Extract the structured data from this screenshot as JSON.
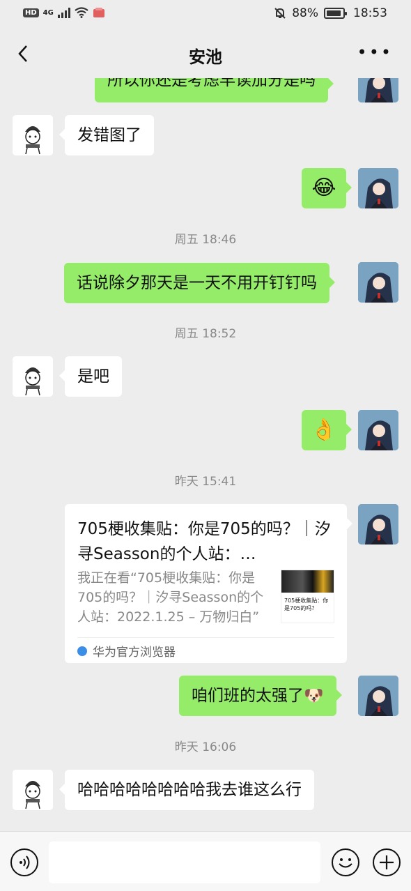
{
  "status": {
    "network": "4G",
    "battery": "88%",
    "time": "18:53"
  },
  "chat": {
    "title": "安池"
  },
  "messages": {
    "m1": "所以你还是考虑早读加分是吗",
    "m2": "发错图了",
    "t1": "周五 18:46",
    "m4": "话说除夕那天是一天不用开钉钉吗",
    "t2": "周五 18:52",
    "m5": "是吧",
    "t3": "昨天 15:41",
    "m7": "咱们班的太强了",
    "t4": "昨天 16:06",
    "m8": "哈哈哈哈哈哈哈哈我去谁这么行"
  },
  "link_card": {
    "title": "705梗收集贴：你是705的吗？｜汐寻Seasson的个人站：…",
    "desc": "我正在看“705梗收集贴：你是705的吗？｜汐寻Seasson的个人站：2022.1.25 – 万物归白”",
    "thumb_text": "705梗收集贴：你是705的吗？",
    "source": "华为官方浏览器"
  },
  "icons": {
    "back": "back-icon",
    "more": "more-icon",
    "voice": "voice-icon",
    "emoji": "emoji-icon",
    "plus": "plus-icon"
  }
}
